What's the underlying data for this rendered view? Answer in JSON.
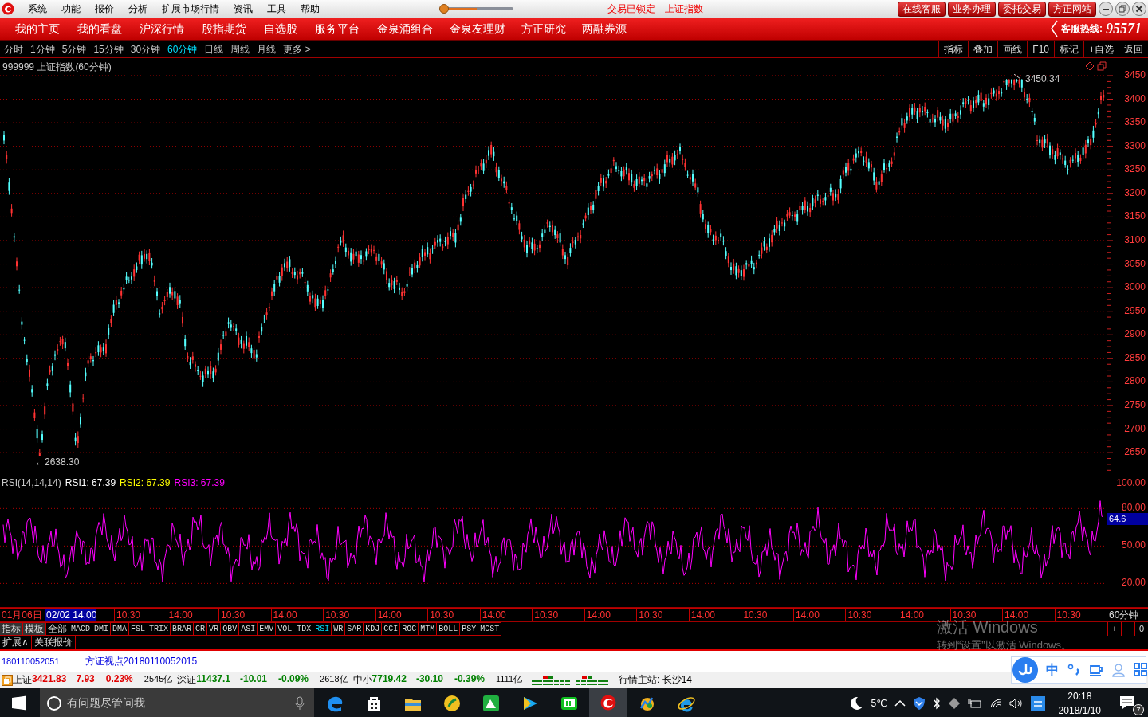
{
  "menu_bar": {
    "items": [
      "系统",
      "功能",
      "报价",
      "分析",
      "扩展市场行情",
      "资讯",
      "工具",
      "帮助"
    ],
    "status_texts": [
      "交易已锁定",
      "上证指数"
    ],
    "buttons": [
      "在线客服",
      "业务办理",
      "委托交易",
      "方正网站"
    ]
  },
  "nav_bar": {
    "items": [
      "我的主页",
      "我的看盘",
      "沪深行情",
      "股指期货",
      "自选股",
      "服务平台",
      "金泉涌组合",
      "金泉友理财",
      "方正研究",
      "两融券源"
    ],
    "hotline_label": "客服热线:",
    "hotline_number": "95571"
  },
  "period_tabs": [
    {
      "label": "分时",
      "selected": false
    },
    {
      "label": "1分钟",
      "selected": false
    },
    {
      "label": "5分钟",
      "selected": false
    },
    {
      "label": "15分钟",
      "selected": false
    },
    {
      "label": "30分钟",
      "selected": false
    },
    {
      "label": "60分钟",
      "selected": true
    },
    {
      "label": "日线",
      "selected": false
    },
    {
      "label": "周线",
      "selected": false
    },
    {
      "label": "月线",
      "selected": false
    },
    {
      "label": "更多 >",
      "selected": false
    }
  ],
  "chart_tools": [
    "指标",
    "叠加",
    "画线",
    "F10",
    "标记",
    "+自选",
    "返回"
  ],
  "price_chart": {
    "title": "999999 上证指数(60分钟)",
    "high_label": "3450.34",
    "low_label": "←2638.30",
    "y_labels": [
      "3450",
      "3400",
      "3350",
      "3300",
      "3250",
      "3200",
      "3150",
      "3100",
      "3050",
      "3000",
      "2950",
      "2900",
      "2850",
      "2800",
      "2750",
      "2700",
      "2650"
    ]
  },
  "rsi_panel": {
    "params": "RSI(14,14,14)",
    "values": [
      {
        "label": "RSI1:",
        "value": "67.39",
        "color": "#ffffff"
      },
      {
        "label": "RSI2:",
        "value": "67.39",
        "color": "#ffff00"
      },
      {
        "label": "RSI3:",
        "value": "67.39",
        "color": "#ff00ff"
      }
    ],
    "y_labels": [
      "100.00",
      "80.00",
      "50.00",
      "20.00"
    ],
    "current": "64.6"
  },
  "time_axis": {
    "labels": [
      {
        "label": "01月06日",
        "selected": false
      },
      {
        "label": "02/02 14:00",
        "selected": true
      },
      {
        "label": "10:30",
        "selected": false
      },
      {
        "label": "14:00",
        "selected": false
      },
      {
        "label": "10:30",
        "selected": false
      },
      {
        "label": "14:00",
        "selected": false
      },
      {
        "label": "10:30",
        "selected": false
      },
      {
        "label": "14:00",
        "selected": false
      },
      {
        "label": "10:30",
        "selected": false
      },
      {
        "label": "14:00",
        "selected": false
      },
      {
        "label": "10:30",
        "selected": false
      },
      {
        "label": "14:00",
        "selected": false
      },
      {
        "label": "10:30",
        "selected": false
      },
      {
        "label": "14:00",
        "selected": false
      },
      {
        "label": "10:30",
        "selected": false
      },
      {
        "label": "14:00",
        "selected": false
      },
      {
        "label": "10:30",
        "selected": false
      },
      {
        "label": "14:00",
        "selected": false
      },
      {
        "label": "10:30",
        "selected": false
      },
      {
        "label": "14:00",
        "selected": false
      },
      {
        "label": "10:30",
        "selected": false
      }
    ],
    "period": "60分钟"
  },
  "indicator_tabs": [
    {
      "label": "指标",
      "selected": false
    },
    {
      "label": "模板",
      "selected": false
    },
    {
      "label": "全部",
      "selected": false
    },
    {
      "label": "MACD",
      "selected": false
    },
    {
      "label": "DMI",
      "selected": false
    },
    {
      "label": "DMA",
      "selected": false
    },
    {
      "label": "FSL",
      "selected": false
    },
    {
      "label": "TRIX",
      "selected": false
    },
    {
      "label": "BRAR",
      "selected": false
    },
    {
      "label": "CR",
      "selected": false
    },
    {
      "label": "VR",
      "selected": false
    },
    {
      "label": "OBV",
      "selected": false
    },
    {
      "label": "ASI",
      "selected": false
    },
    {
      "label": "EMV",
      "selected": false
    },
    {
      "label": "VOL-TDX",
      "selected": false
    },
    {
      "label": "RSI",
      "selected": true
    },
    {
      "label": "WR",
      "selected": false
    },
    {
      "label": "SAR",
      "selected": false
    },
    {
      "label": "KDJ",
      "selected": false
    },
    {
      "label": "CCI",
      "selected": false
    },
    {
      "label": "ROC",
      "selected": false
    },
    {
      "label": "MTM",
      "selected": false
    },
    {
      "label": "BOLL",
      "selected": false
    },
    {
      "label": "PSY",
      "selected": false
    },
    {
      "label": "MCST",
      "selected": false
    }
  ],
  "zoom_controls": [
    "+",
    "−",
    "0"
  ],
  "extra_tabs": [
    "扩展∧",
    "关联报价"
  ],
  "news": [
    "180110052051",
    "方证视点20180110052015"
  ],
  "quotes": [
    {
      "name": "上证",
      "price": "3421.83",
      "change": "7.93",
      "percent": "0.23%",
      "volume": "2545亿",
      "color": "#e00000"
    },
    {
      "name": "深证",
      "price": "11437.1",
      "change": "-10.01",
      "percent": "-0.09%",
      "volume": "2618亿",
      "color": "#008000"
    },
    {
      "name": "中小",
      "price": "7719.42",
      "change": "-30.10",
      "percent": "-0.39%",
      "volume": "1111亿",
      "color": "#008000"
    }
  ],
  "server": "行情主站: 长沙14",
  "activation": {
    "title": "激活 Windows",
    "hint": "转到“设置”以激活 Windows。"
  },
  "ime": {
    "mode": "中"
  },
  "taskbar": {
    "search_placeholder": "有问题尽管问我",
    "apps": [
      {
        "selected": false
      },
      {
        "selected": false
      },
      {
        "selected": false
      },
      {
        "selected": false
      },
      {
        "selected": false
      },
      {
        "selected": false
      },
      {
        "selected": false
      },
      {
        "selected": true
      },
      {
        "selected": false
      },
      {
        "selected": false
      }
    ],
    "temperature": "5℃",
    "time": "20:18",
    "date": "2018/1/10",
    "notifications": "7"
  }
}
